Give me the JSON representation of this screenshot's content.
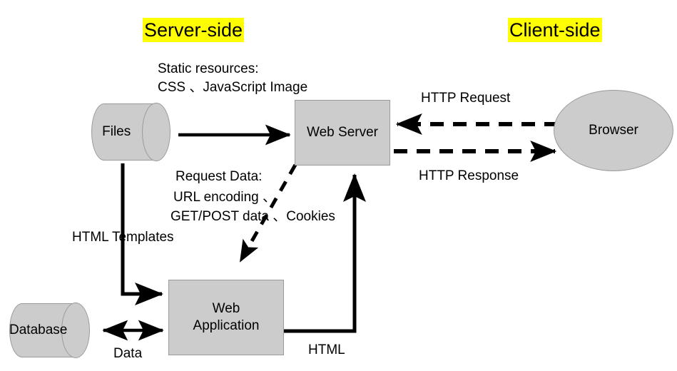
{
  "diagram": {
    "title_server": "Server-side",
    "title_client": "Client-side",
    "nodes": {
      "files": "Files",
      "web_server": "Web Server",
      "browser": "Browser",
      "database": "Database",
      "web_application": "Web\nApplication"
    },
    "labels": {
      "static_resources_line1": "Static resources:",
      "static_resources_line2": "CSS 、JavaScript Image",
      "http_request": "HTTP Request",
      "http_response": "HTTP Response",
      "request_data_line1": "Request Data:",
      "request_data_line2": "URL encoding 、",
      "request_data_line3": "GET/POST data 、Cookies",
      "html_templates": "HTML Templates",
      "data": "Data",
      "html": "HTML"
    },
    "colors": {
      "node_fill": "#cccccc",
      "node_stroke": "#9a9a9a",
      "highlight": "#ffff00",
      "connector": "#000000",
      "text": "#000000",
      "background": "#ffffff"
    },
    "connectors": [
      {
        "name": "files-to-web-server",
        "style": "solid",
        "direction": "right",
        "label": "Static resources: CSS 、JavaScript Image"
      },
      {
        "name": "files-to-web-application",
        "style": "solid",
        "direction": "down-right",
        "label": "HTML Templates"
      },
      {
        "name": "web-server-to-web-application",
        "style": "dashed",
        "direction": "down-left",
        "label": "Request Data: URL encoding 、GET/POST data 、Cookies"
      },
      {
        "name": "web-application-to-web-server",
        "style": "solid",
        "direction": "up",
        "label": "HTML"
      },
      {
        "name": "database-to-web-application",
        "style": "solid",
        "direction": "bidirectional",
        "label": "Data"
      },
      {
        "name": "browser-to-web-server",
        "style": "dashed",
        "direction": "left",
        "label": "HTTP Request"
      },
      {
        "name": "web-server-to-browser",
        "style": "dashed",
        "direction": "right",
        "label": "HTTP Response"
      }
    ]
  }
}
